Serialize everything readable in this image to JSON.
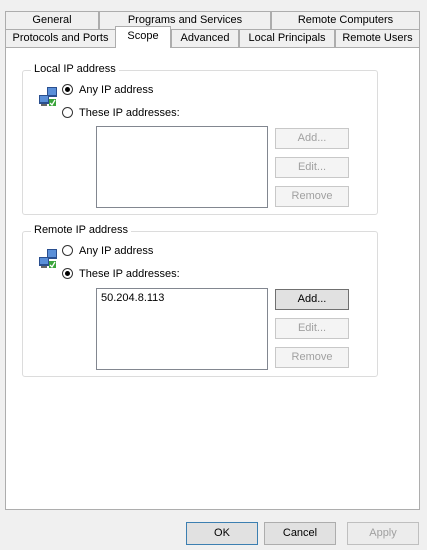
{
  "tabs": {
    "row1": [
      "General",
      "Programs and Services",
      "Remote Computers"
    ],
    "row2": [
      "Protocols and Ports",
      "Scope",
      "Advanced",
      "Local Principals",
      "Remote Users"
    ]
  },
  "local": {
    "title": "Local IP address",
    "any_label": "Any IP address",
    "these_label": "These IP addresses:",
    "selected": "any",
    "addresses": [],
    "add": "Add...",
    "edit": "Edit...",
    "remove": "Remove"
  },
  "remote": {
    "title": "Remote IP address",
    "any_label": "Any IP address",
    "these_label": "These IP addresses:",
    "selected": "these",
    "addresses": [
      "50.204.8.113"
    ],
    "add": "Add...",
    "edit": "Edit...",
    "remove": "Remove"
  },
  "buttons": {
    "ok": "OK",
    "cancel": "Cancel",
    "apply": "Apply"
  }
}
